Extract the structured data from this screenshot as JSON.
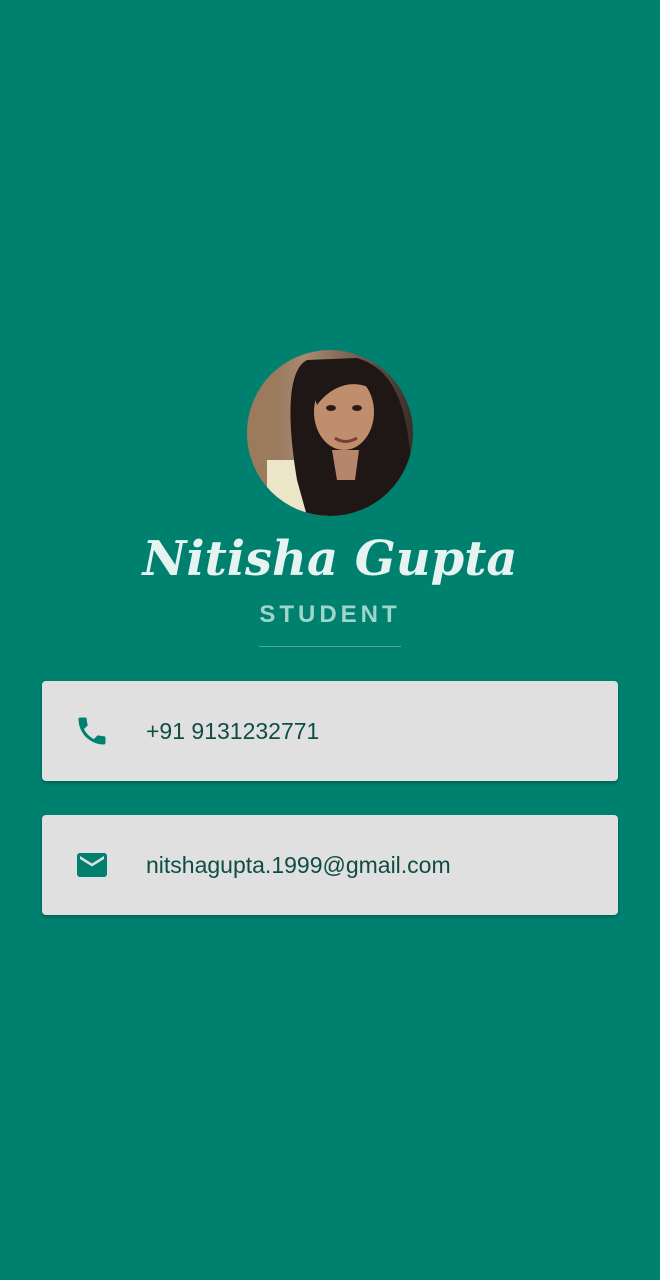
{
  "profile": {
    "name": "Nitisha Gupta",
    "role": "STUDENT"
  },
  "contacts": {
    "phone": {
      "icon": "phone-icon",
      "value": "+91 9131232771"
    },
    "email": {
      "icon": "mail-icon",
      "value": "nitshagupta.1999@gmail.com"
    }
  },
  "colors": {
    "background": "#00806f",
    "card": "#e0e0e0",
    "card_text": "#0e4d44",
    "icon": "#00806f",
    "name": "#e6f4f1",
    "role": "#9ed6cc"
  }
}
